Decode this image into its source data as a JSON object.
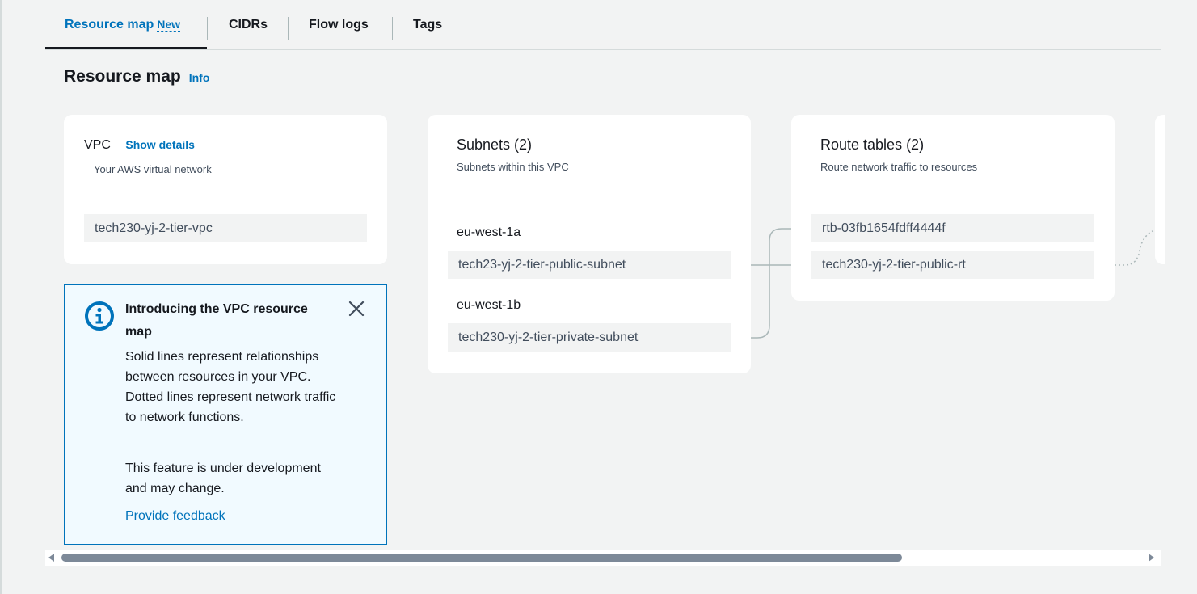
{
  "tabs": [
    {
      "label": "Resource map",
      "badge": "New"
    },
    {
      "label": "CIDRs"
    },
    {
      "label": "Flow logs"
    },
    {
      "label": "Tags"
    }
  ],
  "section": {
    "title": "Resource map",
    "info_link": "Info"
  },
  "vpc_card": {
    "title": "VPC",
    "details_link": "Show details",
    "subtitle": "Your AWS virtual network",
    "vpc_name": "tech230-yj-2-tier-vpc"
  },
  "subnets_card": {
    "title": "Subnets (2)",
    "subtitle": "Subnets within this VPC",
    "zones": [
      {
        "az": "eu-west-1a",
        "subnet": "tech23-yj-2-tier-public-subnet"
      },
      {
        "az": "eu-west-1b",
        "subnet": "tech230-yj-2-tier-private-subnet"
      }
    ]
  },
  "route_tables_card": {
    "title": "Route tables (2)",
    "subtitle": "Route network traffic to resources",
    "tables": [
      "rtb-03fb1654fdff4444f",
      "tech230-yj-2-tier-public-rt"
    ]
  },
  "alert": {
    "icon": "info-icon",
    "title": "Introducing the VPC resource map",
    "body": "Solid lines represent relationships between resources in your VPC. Dotted lines represent network traffic to network functions.",
    "body2": "This feature is under development and may change.",
    "link": "Provide feedback",
    "close_icon": "close-icon"
  },
  "colors": {
    "accent": "#0073bb",
    "background": "#f2f3f3",
    "alert_bg": "#f1faff"
  }
}
